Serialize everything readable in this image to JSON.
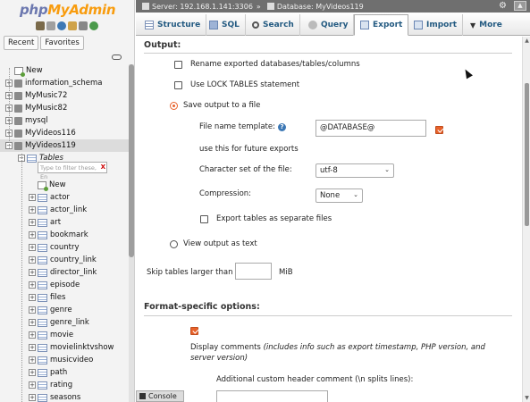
{
  "app": {
    "logo_part1": "php",
    "logo_part2": "MyAdmin"
  },
  "nav": {
    "tabs": [
      "Recent",
      "Favorites"
    ],
    "databases": [
      {
        "label": "New",
        "kind": "new"
      },
      {
        "label": "information_schema",
        "kind": "db"
      },
      {
        "label": "MyMusic72",
        "kind": "db"
      },
      {
        "label": "MyMusic82",
        "kind": "db"
      },
      {
        "label": "mysql",
        "kind": "db"
      },
      {
        "label": "MyVideos116",
        "kind": "db"
      },
      {
        "label": "MyVideos119",
        "kind": "db",
        "expanded": true
      }
    ],
    "tables_group_label": "Tables",
    "filter_placeholder": "Type to filter these, En",
    "filter_clear": "X",
    "table_new_label": "New",
    "tables": [
      "actor",
      "actor_link",
      "art",
      "bookmark",
      "country",
      "country_link",
      "director_link",
      "episode",
      "files",
      "genre",
      "genre_link",
      "movie",
      "movielinktvshow",
      "musicvideo",
      "path",
      "rating",
      "seasons"
    ]
  },
  "topbar": {
    "server": "Server: 192.168.1.141:3306",
    "separator": "»",
    "database": "Database: MyVideos119",
    "collapse": "▲"
  },
  "menu": {
    "tabs": [
      {
        "label": "Structure",
        "icon": "structure-icon",
        "active": false
      },
      {
        "label": "SQL",
        "icon": "sql-icon",
        "active": false
      },
      {
        "label": "Search",
        "icon": "search-icon",
        "active": false
      },
      {
        "label": "Query",
        "icon": "query-icon",
        "active": false
      },
      {
        "label": "Export",
        "icon": "export-icon",
        "active": true
      },
      {
        "label": "Import",
        "icon": "import-icon",
        "active": false
      },
      {
        "label": "More",
        "icon": "more-icon",
        "active": false
      }
    ]
  },
  "output": {
    "legend": "Output:",
    "rename_label": "Rename exported databases/tables/columns",
    "rename_checked": false,
    "lock_label": "Use LOCK TABLES statement",
    "lock_checked": false,
    "save_file_label": "Save output to a file",
    "save_file_selected": true,
    "template_label": "File name template:",
    "template_value": "@DATABASE@",
    "template_remember_checked": true,
    "future_label": "use this for future exports",
    "charset_label": "Character set of the file:",
    "charset_value": "utf-8",
    "compression_label": "Compression:",
    "compression_value": "None",
    "separate_label": "Export tables as separate files",
    "separate_checked": false,
    "view_output_label": "View output as text",
    "view_output_selected": false,
    "skip_label": "Skip tables larger than",
    "skip_value": "",
    "skip_unit": "MiB"
  },
  "format_specific": {
    "legend": "Format-specific options:",
    "comments_checked": true,
    "comments_label": "Display comments",
    "comments_note": "(includes info such as export timestamp, PHP version, and",
    "comments_note2": "server version)",
    "custom_header_label": "Additional custom header comment (\\n splits lines):",
    "custom_header_value": ""
  },
  "console": {
    "label": "Console"
  },
  "colors": {
    "accent": "#e8622b",
    "tab_text": "#235a81",
    "topbar_bg": "#6f6f6f"
  }
}
